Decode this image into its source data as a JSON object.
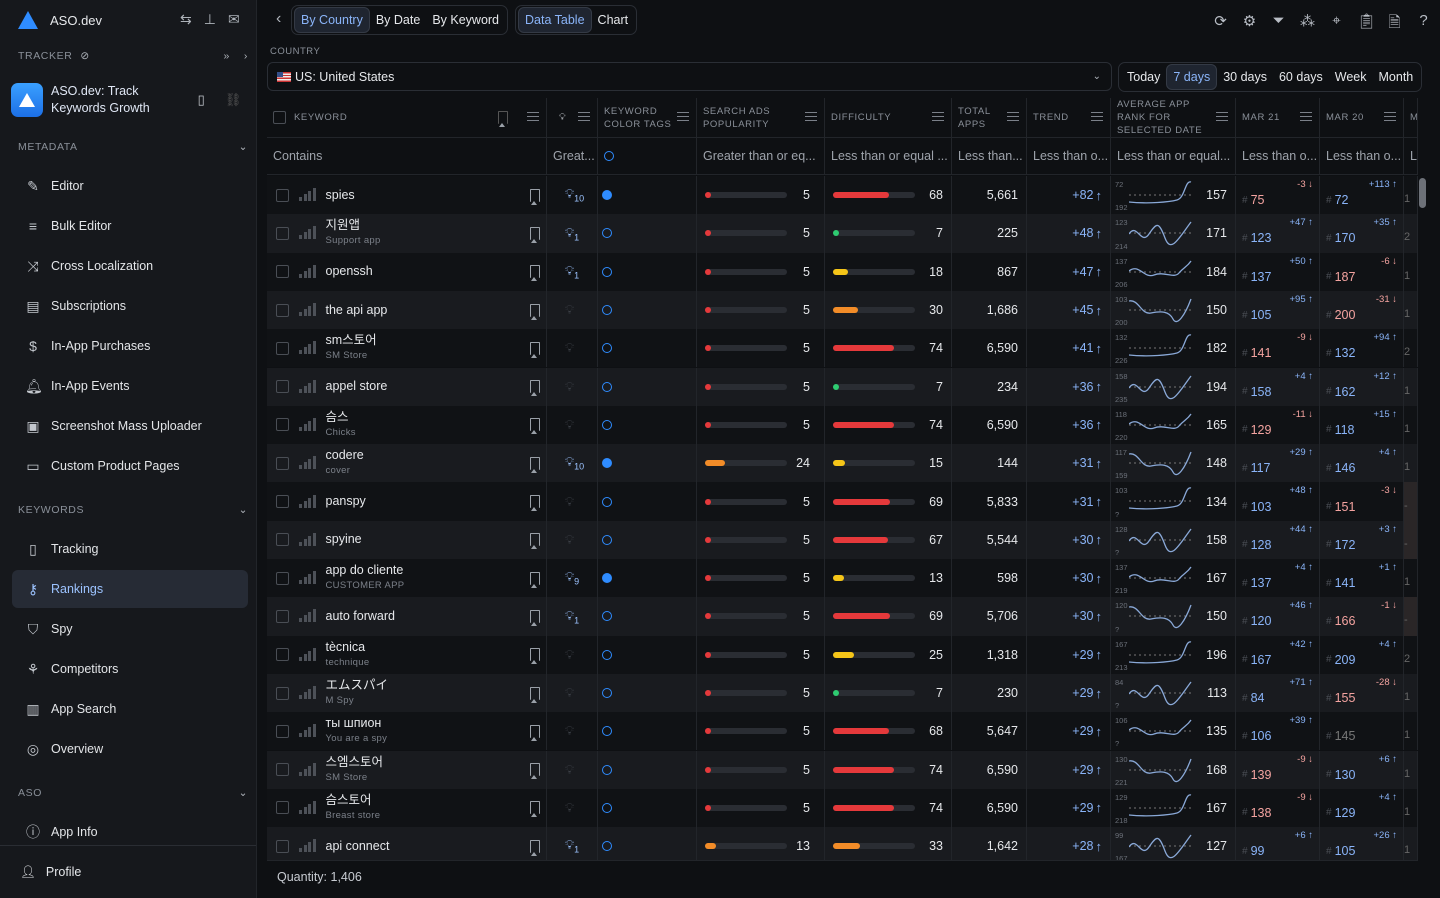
{
  "app": {
    "name": "ASO.dev"
  },
  "sidebar": {
    "tracker_label": "TRACKER",
    "app_title_line1": "ASO.dev: Track",
    "app_title_line2": "Keywords Growth",
    "sections": {
      "metadata": "METADATA",
      "keywords": "KEYWORDS",
      "aso": "ASO"
    },
    "metadata_items": [
      {
        "label": "Editor",
        "icon": "pencil-icon"
      },
      {
        "label": "Bulk Editor",
        "icon": "bulk-edit-icon"
      },
      {
        "label": "Cross Localization",
        "icon": "shuffle-icon"
      },
      {
        "label": "Subscriptions",
        "icon": "subscriptions-icon"
      },
      {
        "label": "In-App Purchases",
        "icon": "dollar-icon"
      },
      {
        "label": "In-App Events",
        "icon": "bell-icon"
      },
      {
        "label": "Screenshot Mass Uploader",
        "icon": "image-upload-icon"
      },
      {
        "label": "Custom Product Pages",
        "icon": "pages-icon"
      }
    ],
    "keyword_items": [
      {
        "label": "Tracking",
        "icon": "book-icon"
      },
      {
        "label": "Rankings",
        "icon": "key-icon",
        "active": true
      },
      {
        "label": "Spy",
        "icon": "shield-icon"
      },
      {
        "label": "Competitors",
        "icon": "competitors-icon"
      },
      {
        "label": "App Search",
        "icon": "bar-chart-icon"
      },
      {
        "label": "Overview",
        "icon": "overview-icon"
      }
    ],
    "aso_items": [
      {
        "label": "App Info",
        "icon": "info-icon"
      }
    ],
    "profile": "Profile"
  },
  "toolbar": {
    "view_tabs": [
      {
        "label": "By Country",
        "active": true
      },
      {
        "label": "By Date"
      },
      {
        "label": "By Keyword"
      }
    ],
    "mode_tabs": [
      {
        "label": "Data Table",
        "active": true
      },
      {
        "label": "Chart"
      }
    ],
    "icons": [
      "refresh-icon",
      "gear-icon",
      "filter-icon",
      "clusters-icon",
      "focus-icon",
      "clipboard-icon",
      "export-icon",
      "help-icon"
    ]
  },
  "country": {
    "label": "COUNTRY",
    "value": "US: United States"
  },
  "periods": [
    {
      "label": "Today"
    },
    {
      "label": "7 days",
      "active": true
    },
    {
      "label": "30 days"
    },
    {
      "label": "60 days"
    },
    {
      "label": "Week"
    },
    {
      "label": "Month"
    }
  ],
  "columns": {
    "keyword": "KEYWORD",
    "tags": "KEYWORD COLOR TAGS",
    "popularity": "SEARCH ADS POPULARITY",
    "difficulty": "DIFFICULTY",
    "total": "TOTAL APPS",
    "trend": "TREND",
    "avg": "AVERAGE APP RANK FOR SELECTED DATE",
    "mar21": "MAR 21",
    "mar20": "MAR 20",
    "next": "MA"
  },
  "filters": {
    "keyword": "Contains",
    "ideas": "Great...",
    "popularity": "Greater than or eq...",
    "difficulty": "Less than or equal ...",
    "total": "Less than...",
    "trend": "Less than o...",
    "avg": "Less than or equal...",
    "mar21": "Less than o...",
    "mar20": "Less than o...",
    "next": "Les"
  },
  "colors": {
    "accent": "#8ab4f8",
    "tag": "#2f8cff",
    "red": "#e5393b",
    "green": "#2ecc71",
    "yellow": "#f5c518",
    "orange": "#f28c28",
    "negative": "#f4a3a0"
  },
  "rows": [
    {
      "kw": "spies",
      "sub": "",
      "ideas": "10",
      "tag": true,
      "pop": 5,
      "diff": 68,
      "total": "5,661",
      "trend": "+82",
      "hi": "72",
      "lo": "192",
      "avg": "157",
      "r21": "75",
      "c21": "-3",
      "r20": "72",
      "c20": "+113",
      "next": "1"
    },
    {
      "kw": "지원앱",
      "sub": "Support app",
      "ideas": "1",
      "tag": false,
      "pop": 5,
      "diff": 7,
      "total": "225",
      "trend": "+48",
      "hi": "123",
      "lo": "214",
      "avg": "171",
      "r21": "123",
      "c21": "+47",
      "r20": "170",
      "c20": "+35",
      "next": "2"
    },
    {
      "kw": "openssh",
      "sub": "",
      "ideas": "1",
      "tag": false,
      "pop": 5,
      "diff": 18,
      "total": "867",
      "trend": "+47",
      "hi": "137",
      "lo": "206",
      "avg": "184",
      "r21": "137",
      "c21": "+50",
      "r20": "187",
      "c20": "-6",
      "next": "1"
    },
    {
      "kw": "the api app",
      "sub": "",
      "ideas": "",
      "tag": false,
      "pop": 5,
      "diff": 30,
      "total": "1,686",
      "trend": "+45",
      "hi": "103",
      "lo": "200",
      "avg": "150",
      "r21": "105",
      "c21": "+95",
      "r20": "200",
      "c20": "-31",
      "next": "1"
    },
    {
      "kw": "sm스토어",
      "sub": "SM Store",
      "ideas": "",
      "tag": false,
      "pop": 5,
      "diff": 74,
      "total": "6,590",
      "trend": "+41",
      "hi": "132",
      "lo": "226",
      "avg": "182",
      "r21": "141",
      "c21": "-9",
      "r20": "132",
      "c20": "+94",
      "next": "2"
    },
    {
      "kw": "appel store",
      "sub": "",
      "ideas": "",
      "tag": false,
      "pop": 5,
      "diff": 7,
      "total": "234",
      "trend": "+36",
      "hi": "158",
      "lo": "235",
      "avg": "194",
      "r21": "158",
      "c21": "+4",
      "r20": "162",
      "c20": "+12",
      "next": "1"
    },
    {
      "kw": "슴스",
      "sub": "Chicks",
      "ideas": "",
      "tag": false,
      "pop": 5,
      "diff": 74,
      "total": "6,590",
      "trend": "+36",
      "hi": "118",
      "lo": "220",
      "avg": "165",
      "r21": "129",
      "c21": "-11",
      "r20": "118",
      "c20": "+15",
      "next": "1"
    },
    {
      "kw": "codere",
      "sub": "cover",
      "ideas": "10",
      "tag": true,
      "pop": 24,
      "diff": 15,
      "total": "144",
      "trend": "+31",
      "hi": "117",
      "lo": "159",
      "avg": "148",
      "r21": "117",
      "c21": "+29",
      "r20": "146",
      "c20": "+4",
      "next": "1"
    },
    {
      "kw": "panspy",
      "sub": "",
      "ideas": "",
      "tag": false,
      "pop": 5,
      "diff": 69,
      "total": "5,833",
      "trend": "+31",
      "hi": "103",
      "lo": "?",
      "avg": "134",
      "r21": "103",
      "c21": "+48",
      "r20": "151",
      "c20": "-3",
      "next": "-"
    },
    {
      "kw": "spyine",
      "sub": "",
      "ideas": "",
      "tag": false,
      "pop": 5,
      "diff": 67,
      "total": "5,544",
      "trend": "+30",
      "hi": "128",
      "lo": "?",
      "avg": "158",
      "r21": "128",
      "c21": "+44",
      "r20": "172",
      "c20": "+3",
      "next": "-"
    },
    {
      "kw": "app do cliente",
      "sub": "CUSTOMER APP",
      "ideas": "9",
      "tag": true,
      "pop": 5,
      "diff": 13,
      "total": "598",
      "trend": "+30",
      "hi": "137",
      "lo": "219",
      "avg": "167",
      "r21": "137",
      "c21": "+4",
      "r20": "141",
      "c20": "+1",
      "next": "1"
    },
    {
      "kw": "auto forward",
      "sub": "",
      "ideas": "1",
      "tag": false,
      "pop": 5,
      "diff": 69,
      "total": "5,706",
      "trend": "+30",
      "hi": "120",
      "lo": "?",
      "avg": "150",
      "r21": "120",
      "c21": "+46",
      "r20": "166",
      "c20": "-1",
      "next": "-"
    },
    {
      "kw": "tècnica",
      "sub": "technique",
      "ideas": "",
      "tag": false,
      "pop": 5,
      "diff": 25,
      "total": "1,318",
      "trend": "+29",
      "hi": "167",
      "lo": "213",
      "avg": "196",
      "r21": "167",
      "c21": "+42",
      "r20": "209",
      "c20": "+4",
      "next": "2"
    },
    {
      "kw": "エムスパイ",
      "sub": "M Spy",
      "ideas": "",
      "tag": false,
      "pop": 5,
      "diff": 7,
      "total": "230",
      "trend": "+29",
      "hi": "84",
      "lo": "?",
      "avg": "113",
      "r21": "84",
      "c21": "+71",
      "r20": "155",
      "c20": "-28",
      "next": "1"
    },
    {
      "kw": "ты шпион",
      "sub": "You are a spy",
      "ideas": "",
      "tag": false,
      "pop": 5,
      "diff": 68,
      "total": "5,647",
      "trend": "+29",
      "hi": "106",
      "lo": "?",
      "avg": "135",
      "r21": "106",
      "c21": "+39",
      "r20": "145",
      "c20": "",
      "next": "1"
    },
    {
      "kw": "스엠스토어",
      "sub": "SM Store",
      "ideas": "",
      "tag": false,
      "pop": 5,
      "diff": 74,
      "total": "6,590",
      "trend": "+29",
      "hi": "130",
      "lo": "221",
      "avg": "168",
      "r21": "139",
      "c21": "-9",
      "r20": "130",
      "c20": "+6",
      "next": "1"
    },
    {
      "kw": "슴스토어",
      "sub": "Breast store",
      "ideas": "",
      "tag": false,
      "pop": 5,
      "diff": 74,
      "total": "6,590",
      "trend": "+29",
      "hi": "129",
      "lo": "218",
      "avg": "167",
      "r21": "138",
      "c21": "-9",
      "r20": "129",
      "c20": "+4",
      "next": "1"
    },
    {
      "kw": "api connect",
      "sub": "",
      "ideas": "1",
      "tag": false,
      "pop": 13,
      "diff": 33,
      "total": "1,642",
      "trend": "+28",
      "hi": "99",
      "lo": "167",
      "avg": "127",
      "r21": "99",
      "c21": "+6",
      "r20": "105",
      "c20": "+26",
      "next": "1"
    }
  ],
  "footer": {
    "quantity": "Quantity: 1,406"
  }
}
